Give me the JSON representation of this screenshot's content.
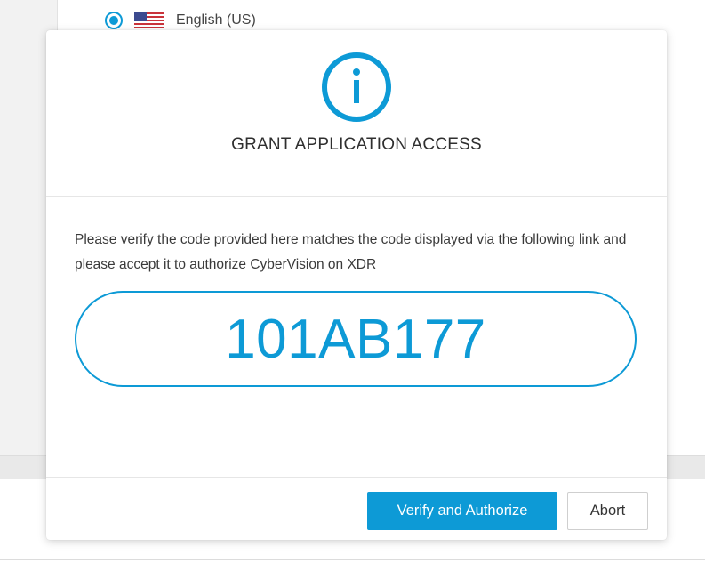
{
  "background": {
    "language": {
      "label": "English (US)",
      "selected": true,
      "flag_icon": "us-flag-icon"
    }
  },
  "modal": {
    "icon": "info-circle-icon",
    "title": "GRANT APPLICATION ACCESS",
    "message": "Please verify the code provided here matches the code displayed via the following link and please accept it to authorize CyberVision on XDR",
    "code": "101AB177",
    "primary_button": "Verify and Authorize",
    "secondary_button": "Abort"
  },
  "colors": {
    "accent": "#0d9ad6"
  }
}
